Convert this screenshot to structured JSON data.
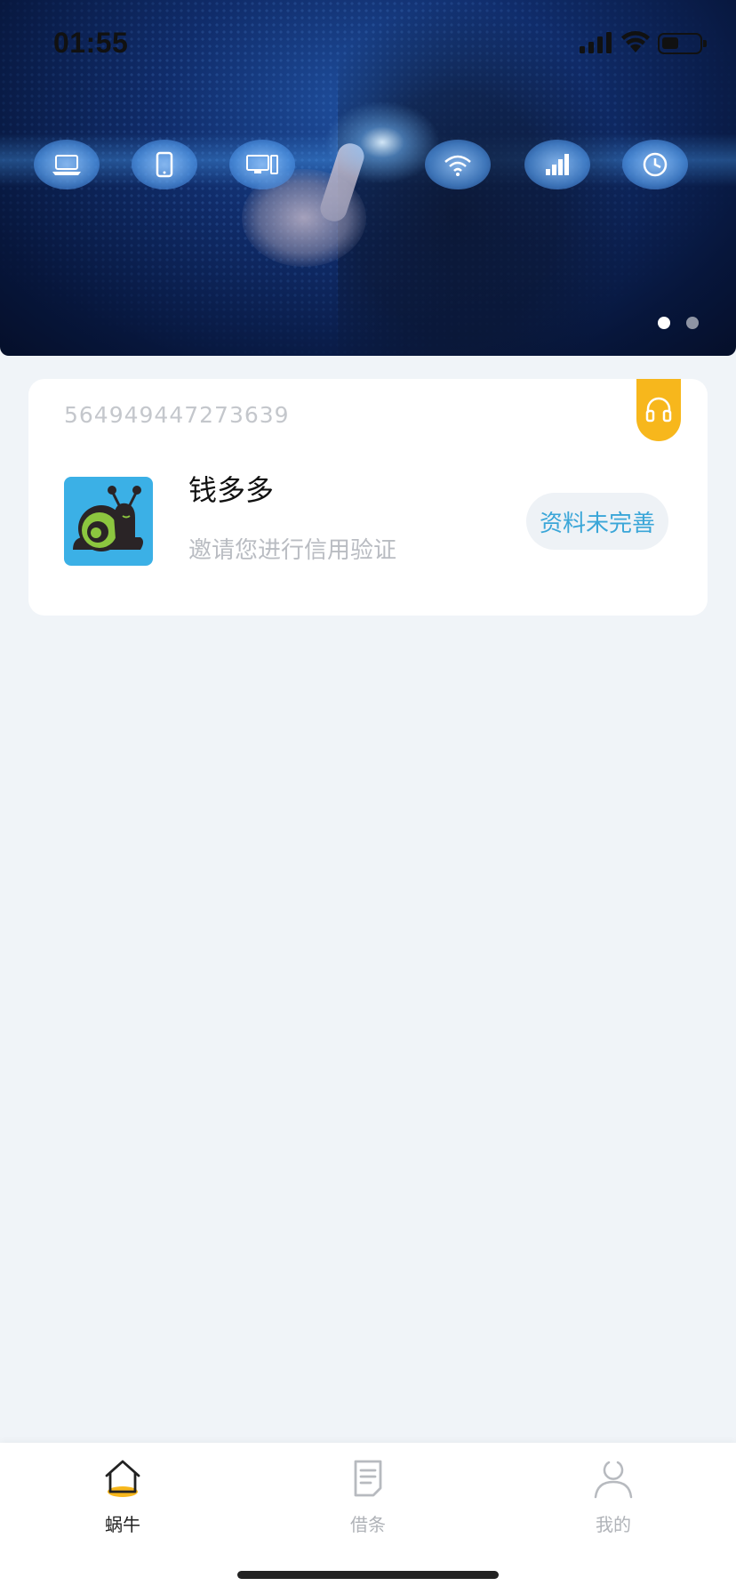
{
  "status_bar": {
    "time": "01:55"
  },
  "banner": {
    "icons": [
      "laptop-icon",
      "tablet-icon",
      "desktop-icon",
      "wifi-icon",
      "signal-icon",
      "clock-icon"
    ],
    "slides": 2,
    "active_slide": 0
  },
  "card": {
    "id": "564949447273639",
    "brand_name": "钱多多",
    "subtitle": "邀请您进行信用验证",
    "status_button": "资料未完善",
    "service_icon": "headset-icon",
    "accent_color": "#f7b71c"
  },
  "tabbar": {
    "items": [
      {
        "label": "蜗牛",
        "icon": "home-icon",
        "active": true
      },
      {
        "label": "借条",
        "icon": "document-icon",
        "active": false
      },
      {
        "label": "我的",
        "icon": "user-icon",
        "active": false
      }
    ]
  },
  "colors": {
    "page_bg": "#f0f4f8",
    "link_blue": "#3aa6d8",
    "logo_bg": "#3bb0e6"
  }
}
